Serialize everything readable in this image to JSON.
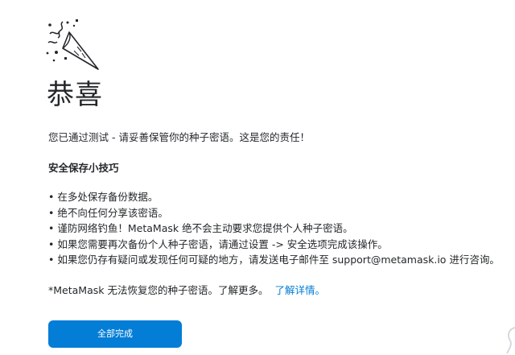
{
  "confetti_icon": "party-popper-icon",
  "title": "恭喜",
  "intro": "您已通过测试 - 请妥善保管你的种子密语。这是您的责任！",
  "tips": {
    "heading": "安全保存小技巧",
    "items": [
      "在多处保存备份数据。",
      "绝不向任何分享该密语。",
      "谨防网络钓鱼！MetaMask 绝不会主动要求您提供个人种子密语。",
      "如果您需要再次备份个人种子密语，请通过设置 -> 安全选项完成该操作。",
      "如果您仍存有疑问或发现任何可疑的地方，请发送电子邮件至 support@metamask.io 进行咨询。"
    ]
  },
  "footnote": {
    "text": "*MetaMask 无法恢复您的种子密语。了解更多。",
    "link_label": "了解详情。"
  },
  "done_button_label": "全部完成",
  "colors": {
    "accent": "#037dd6",
    "text": "#24272a"
  }
}
